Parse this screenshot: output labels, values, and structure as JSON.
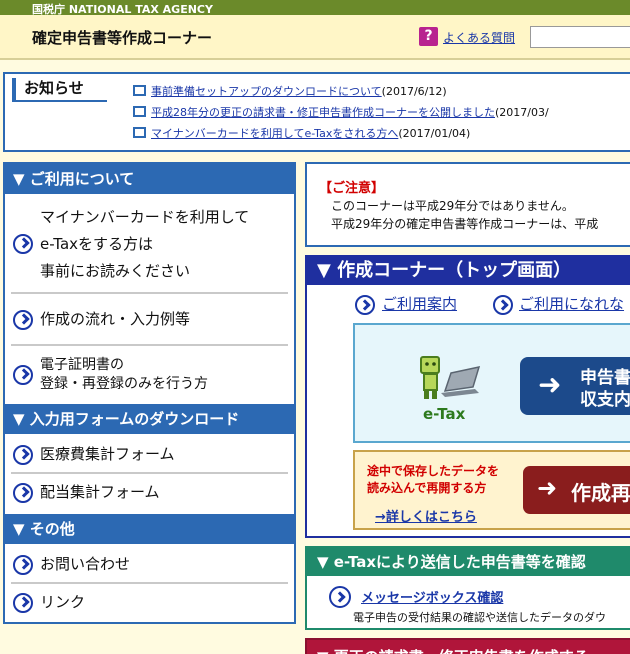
{
  "header": {
    "agency": "国税庁 NATIONAL TAX AGENCY",
    "title": "確定申告書等作成コーナー",
    "faq_icon": "?",
    "faq_label": "よくある質問"
  },
  "notice": {
    "title": "お知らせ",
    "items": [
      {
        "link": "事前準備セットアップのダウンロードについて",
        "date": "(2017/6/12)"
      },
      {
        "link": "平成28年分の更正の請求書・修正申告書作成コーナーを公開しました",
        "date": "(2017/03/"
      },
      {
        "link": "マイナンバーカードを利用してe-Taxをされる方へ",
        "date": "(2017/01/04)"
      }
    ]
  },
  "sidebar": {
    "sections": [
      {
        "title": "▼ ご利用について"
      },
      {
        "title": "▼ 入力用フォームのダウンロード"
      },
      {
        "title": "▼ その他"
      }
    ],
    "items": [
      {
        "lines": [
          "マイナンバーカードを利用して",
          "e-Taxをする方は",
          "事前にお読みください"
        ]
      },
      {
        "lines": [
          "作成の流れ・入力例等"
        ]
      },
      {
        "lines": [
          "電子証明書の",
          "登録・再登録のみを行う方"
        ]
      },
      {
        "lines": [
          "医療費集計フォーム"
        ]
      },
      {
        "lines": [
          "配当集計フォーム"
        ]
      },
      {
        "lines": [
          "お問い合わせ"
        ]
      },
      {
        "lines": [
          "リンク"
        ]
      }
    ]
  },
  "caution": {
    "title": "【ご注意】",
    "line1": "このコーナーは平成29年分ではありません。",
    "line2": "平成29年分の確定申告書等作成コーナーは、平成"
  },
  "corner": {
    "title": "▼ 作成コーナー（トップ画面）",
    "link1": "ご利用案内",
    "link2": "ご利用になれな",
    "etax_label": "e-Tax",
    "button_l1": "申告書",
    "button_l2": "収支内",
    "resume_l1": "途中で保存したデータを",
    "resume_l2": "読み込んで再開する方",
    "resume_link": "→詳しくはこちら",
    "resume_button": "作成再"
  },
  "sent": {
    "title": "▼ e-Taxにより送信した申告書等を確認",
    "link": "メッセージボックス確認",
    "desc": "電子申告の受付結果の確認や送信したデータのダウ"
  },
  "revise": {
    "title": "▼ 更正の請求書・修正申告書を作成する"
  },
  "colors": {
    "agency_band": "#6b8a2a",
    "header_bg": "#fff6c7",
    "primary_blue": "#2c69b3",
    "navy": "#1f2f9f",
    "green": "#1f8a6b",
    "red": "#b0153a",
    "link": "#1a37a8"
  }
}
